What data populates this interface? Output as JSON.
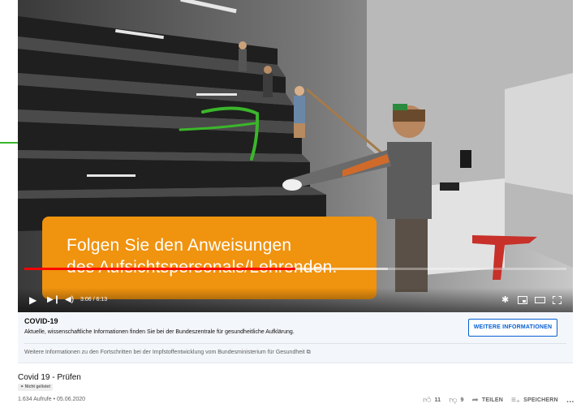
{
  "video": {
    "caption_line1": "Folgen Sie den Anweisungen",
    "caption_line2": "des Aufsichtspersonals/Lehrenden.",
    "time_display": "3:06 / 6:13",
    "progress_played": 0.5,
    "progress_buffered": 0.67,
    "icons": [
      "play-icon",
      "next-icon",
      "volume-icon",
      "settings-icon",
      "miniplayer-icon",
      "theater-icon",
      "fullscreen-icon"
    ]
  },
  "info_panel": {
    "title": "COVID-19",
    "text": "Aktuelle, wissenschaftliche Informationen finden Sie bei der Bundeszentrale für gesundheitliche Aufklärung.",
    "button_label": "WEITERE INFORMATIONEN",
    "link_text": "Weitere Informationen zu den Fortschritten bei der Impfstoffentwicklung vom Bundesministerium für Gesundheit ⧉"
  },
  "meta": {
    "title": "Covid 19 - Prüfen",
    "unlisted_label": "Nicht gelistet",
    "views_date": "1.634 Aufrufe • 05.06.2020",
    "like_count": "11",
    "dislike_count": "9",
    "share_label": "TEILEN",
    "save_label": "SPEICHERN",
    "more_label": "…"
  },
  "colors": {
    "caption_bg": "#f0930f",
    "progress_red": "#ff0000",
    "link_blue": "#065fd4",
    "annotation_green": "#3bb62b"
  }
}
